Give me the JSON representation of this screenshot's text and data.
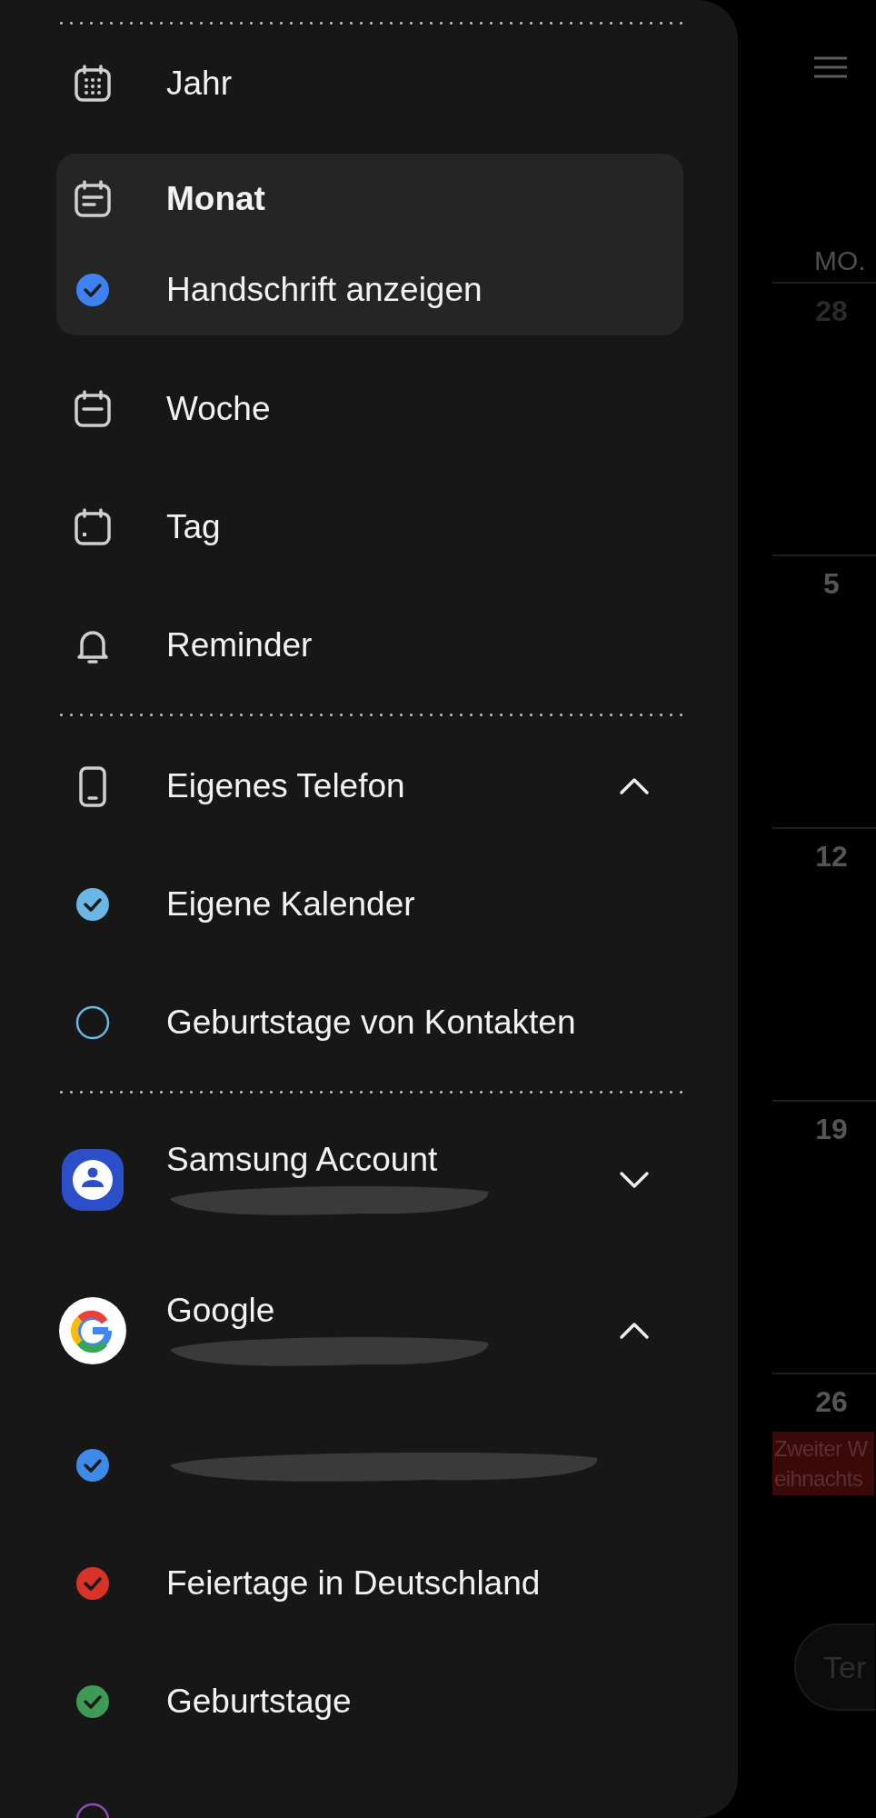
{
  "drawer": {
    "views": [
      {
        "label": "Jahr",
        "kind": "year",
        "selected": false
      },
      {
        "label": "Monat",
        "kind": "month",
        "selected": true,
        "option": {
          "label": "Handschrift anzeigen",
          "checked": true,
          "color": "#3d82f0"
        }
      },
      {
        "label": "Woche",
        "kind": "week",
        "selected": false
      },
      {
        "label": "Tag",
        "kind": "day",
        "selected": false
      },
      {
        "label": "Reminder",
        "kind": "bell",
        "selected": false
      }
    ],
    "accounts": [
      {
        "name": "Eigenes Telefon",
        "kind": "phone",
        "expanded": true,
        "calendars": [
          {
            "name": "Eigene Kalender",
            "checked": true,
            "color": "#6ab6e4"
          },
          {
            "name": "Geburtstage von Kontakten",
            "checked": false,
            "color": "#6ab6e4"
          }
        ]
      },
      {
        "name": "Samsung Account",
        "kind": "samsung",
        "expanded": false,
        "redacted": true
      },
      {
        "name": "Google",
        "kind": "google",
        "expanded": true,
        "redacted": true,
        "calendars": [
          {
            "redacted": true,
            "checked": true,
            "color": "#3d8ae8"
          },
          {
            "name": "Feiertage in Deutschland",
            "checked": true,
            "color": "#d93228"
          },
          {
            "name": "Geburtstage",
            "checked": true,
            "color": "#3d9b55"
          },
          {
            "checked": false,
            "color": "#8a4db5"
          }
        ]
      }
    ]
  },
  "calendar": {
    "weekday": "MO.",
    "weeks": [
      {
        "day": "28",
        "other_month": true
      },
      {
        "day": "5",
        "other_month": false
      },
      {
        "day": "12",
        "other_month": false
      },
      {
        "day": "19",
        "other_month": false
      },
      {
        "day": "26",
        "other_month": false,
        "events": [
          {
            "lines": [
              "Zweiter W",
              "eihnachts"
            ],
            "color": "#3a0a0a"
          }
        ]
      }
    ],
    "add_button": "Ter"
  }
}
